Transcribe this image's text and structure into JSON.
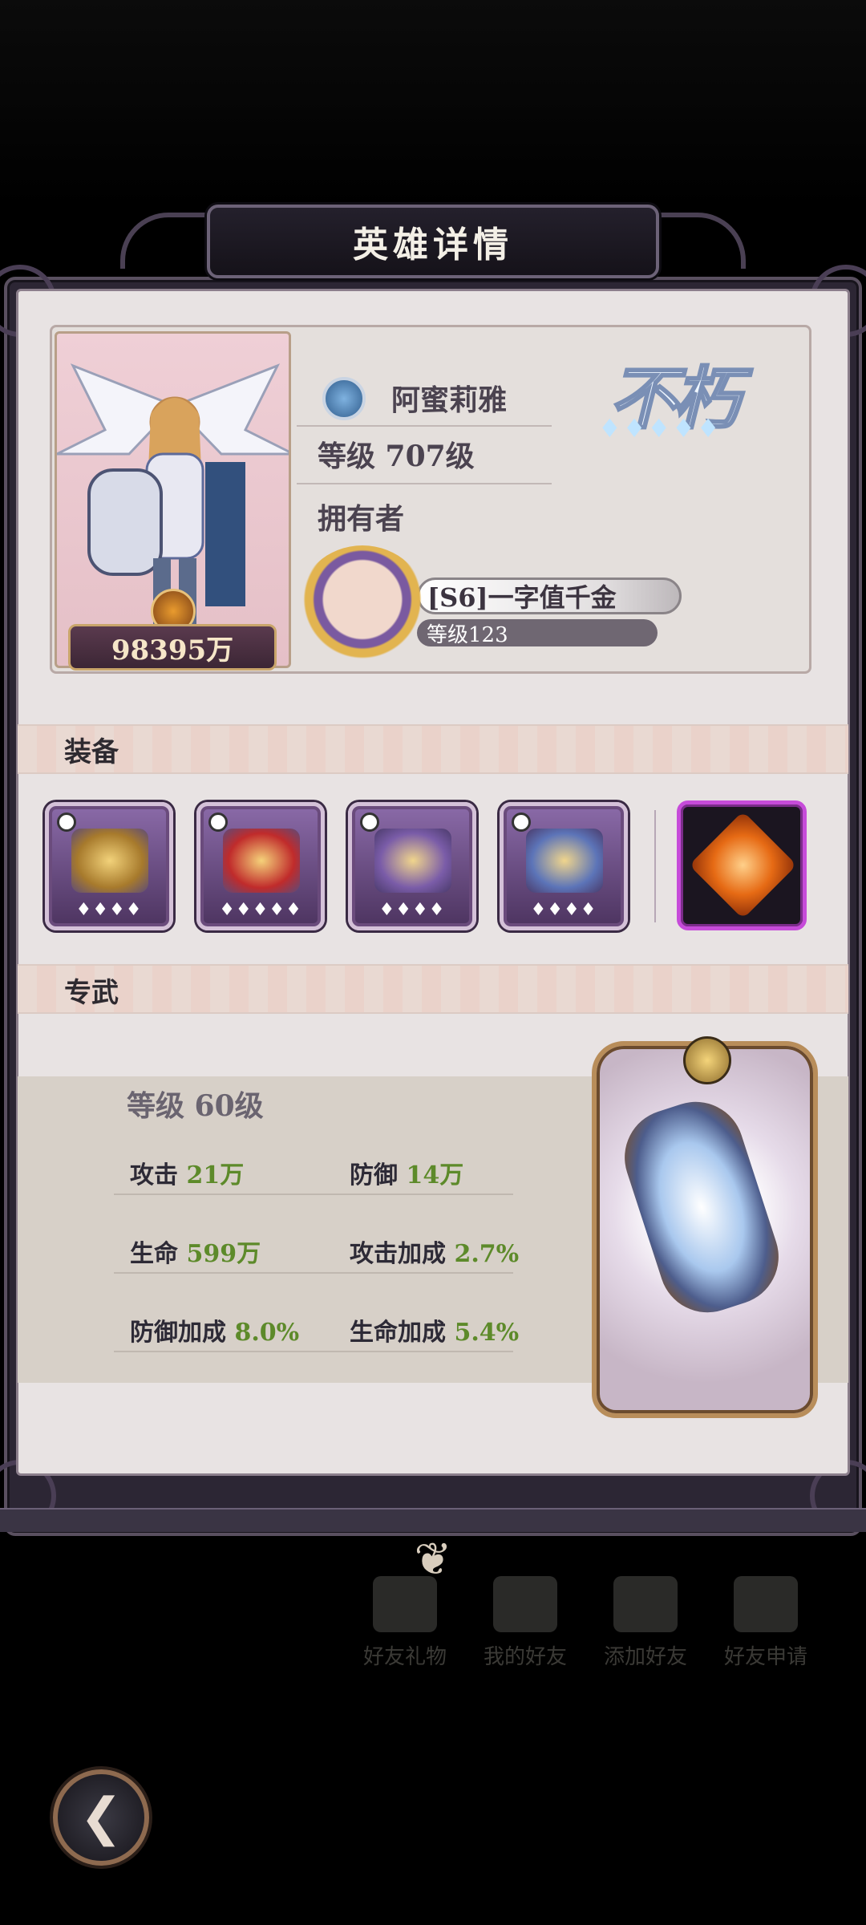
{
  "dialog": {
    "title": "英雄详情"
  },
  "hero": {
    "name": "阿蜜莉雅",
    "level": "等级 707级",
    "power": "98395万",
    "grade": "不朽",
    "grade_stars": "♦♦♦♦♦"
  },
  "owner": {
    "label": "拥有者",
    "name": "[S6]一字值千金",
    "level": "等级123"
  },
  "equipment": {
    "title": "装备",
    "slots": [
      {
        "stars": "♦♦♦♦"
      },
      {
        "stars": "♦♦♦♦♦"
      },
      {
        "stars": "♦♦♦♦"
      },
      {
        "stars": "♦♦♦♦"
      }
    ]
  },
  "exclusive": {
    "title": "专武",
    "level": "等级 60级",
    "stats": [
      {
        "label": "攻击",
        "value": "21万"
      },
      {
        "label": "防御",
        "value": "14万"
      },
      {
        "label": "生命",
        "value": "599万"
      },
      {
        "label": "攻击加成",
        "value": "2.7%"
      },
      {
        "label": "防御加成",
        "value": "8.0%"
      },
      {
        "label": "生命加成",
        "value": "5.4%"
      }
    ]
  },
  "background": {
    "buttons": [
      "好友礼物",
      "我的好友",
      "添加好友",
      "好友申请"
    ]
  }
}
